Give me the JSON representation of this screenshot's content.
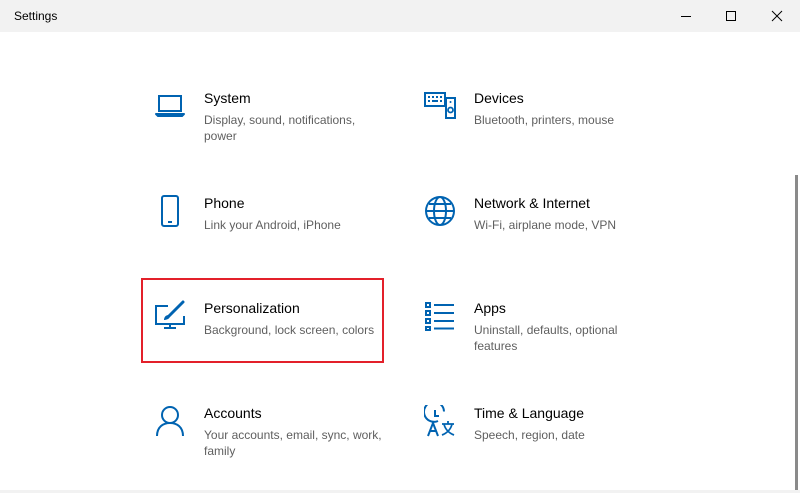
{
  "window": {
    "title": "Settings",
    "controls": [
      "minimize",
      "maximize",
      "close"
    ]
  },
  "tiles": [
    {
      "name": "System",
      "description": "Display, sound, notifications, power",
      "icon": "laptop-icon"
    },
    {
      "name": "Devices",
      "description": "Bluetooth, printers, mouse",
      "icon": "keyboard-speaker-icon"
    },
    {
      "name": "Phone",
      "description": "Link your Android, iPhone",
      "icon": "phone-icon"
    },
    {
      "name": "Network & Internet",
      "description": "Wi-Fi, airplane mode, VPN",
      "icon": "globe-icon"
    },
    {
      "name": "Personalization",
      "description": "Background, lock screen, colors",
      "icon": "paintbrush-monitor-icon"
    },
    {
      "name": "Apps",
      "description": "Uninstall, defaults, optional features",
      "icon": "apps-list-icon"
    },
    {
      "name": "Accounts",
      "description": "Your accounts, email, sync, work, family",
      "icon": "person-icon"
    },
    {
      "name": "Time & Language",
      "description": "Speech, region, date",
      "icon": "time-language-icon"
    }
  ],
  "colors": {
    "accent": "#0063b1",
    "highlight": "#e3202a",
    "description_text": "#5f5f5f",
    "titlebar": "#f2f2f2"
  }
}
